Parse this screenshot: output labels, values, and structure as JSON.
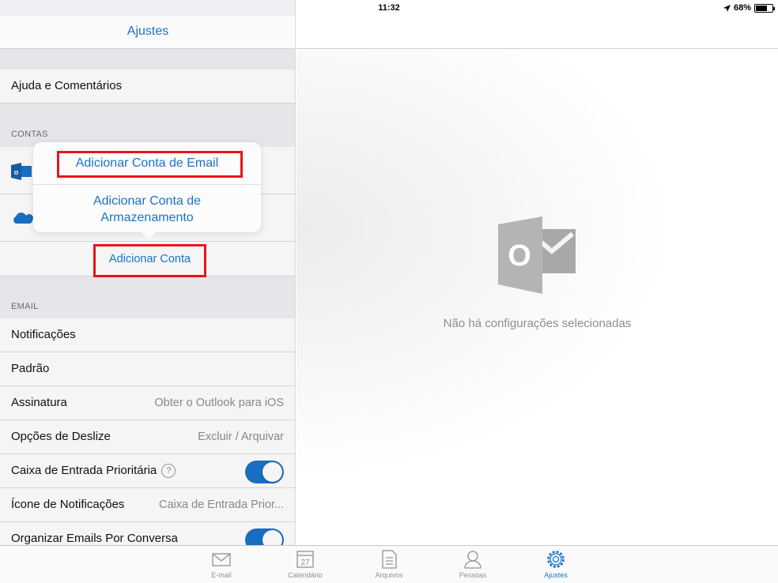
{
  "status_bar": {
    "device": "iPad",
    "time": "11:32",
    "battery": "68%",
    "battery_level": 0.68
  },
  "left_header": {
    "title": "Ajustes"
  },
  "help_row": {
    "label": "Ajuda e Comentários"
  },
  "contas": {
    "header": "CONTAS",
    "add_account_label": "Adicionar Conta"
  },
  "popover": {
    "item1": "Adicionar Conta de Email",
    "item2_line1": "Adicionar Conta de",
    "item2_line2": "Armazenamento"
  },
  "email": {
    "header": "EMAIL",
    "rows": [
      {
        "label": "Notificações",
        "value": ""
      },
      {
        "label": "Padrão",
        "value": ""
      },
      {
        "label": "Assinatura",
        "value": "Obter o Outlook para iOS"
      },
      {
        "label": "Opções de Deslize",
        "value": "Excluir / Arquivar"
      },
      {
        "label": "Caixa de Entrada Prioritária",
        "value": "",
        "toggle": true
      },
      {
        "label": "Ícone de Notificações",
        "value": "Caixa de Entrada Prior..."
      },
      {
        "label": "Organizar Emails Por Conversa",
        "value": "",
        "toggle": true
      }
    ],
    "help_icon": "?"
  },
  "right": {
    "empty_message": "Não há configurações selecionadas",
    "logo_letter": "O"
  },
  "calendar_day": "27",
  "tabs": [
    {
      "label": "E-mail",
      "icon": "mail-icon"
    },
    {
      "label": "Calendário",
      "icon": "calendar-icon"
    },
    {
      "label": "Arquivos",
      "icon": "files-icon"
    },
    {
      "label": "Pessoas",
      "icon": "people-icon"
    },
    {
      "label": "Ajustes",
      "icon": "settings-icon",
      "active": true
    }
  ],
  "colors": {
    "accent": "#1a73c8",
    "highlight": "#e8141c",
    "background": "#efeff4"
  }
}
